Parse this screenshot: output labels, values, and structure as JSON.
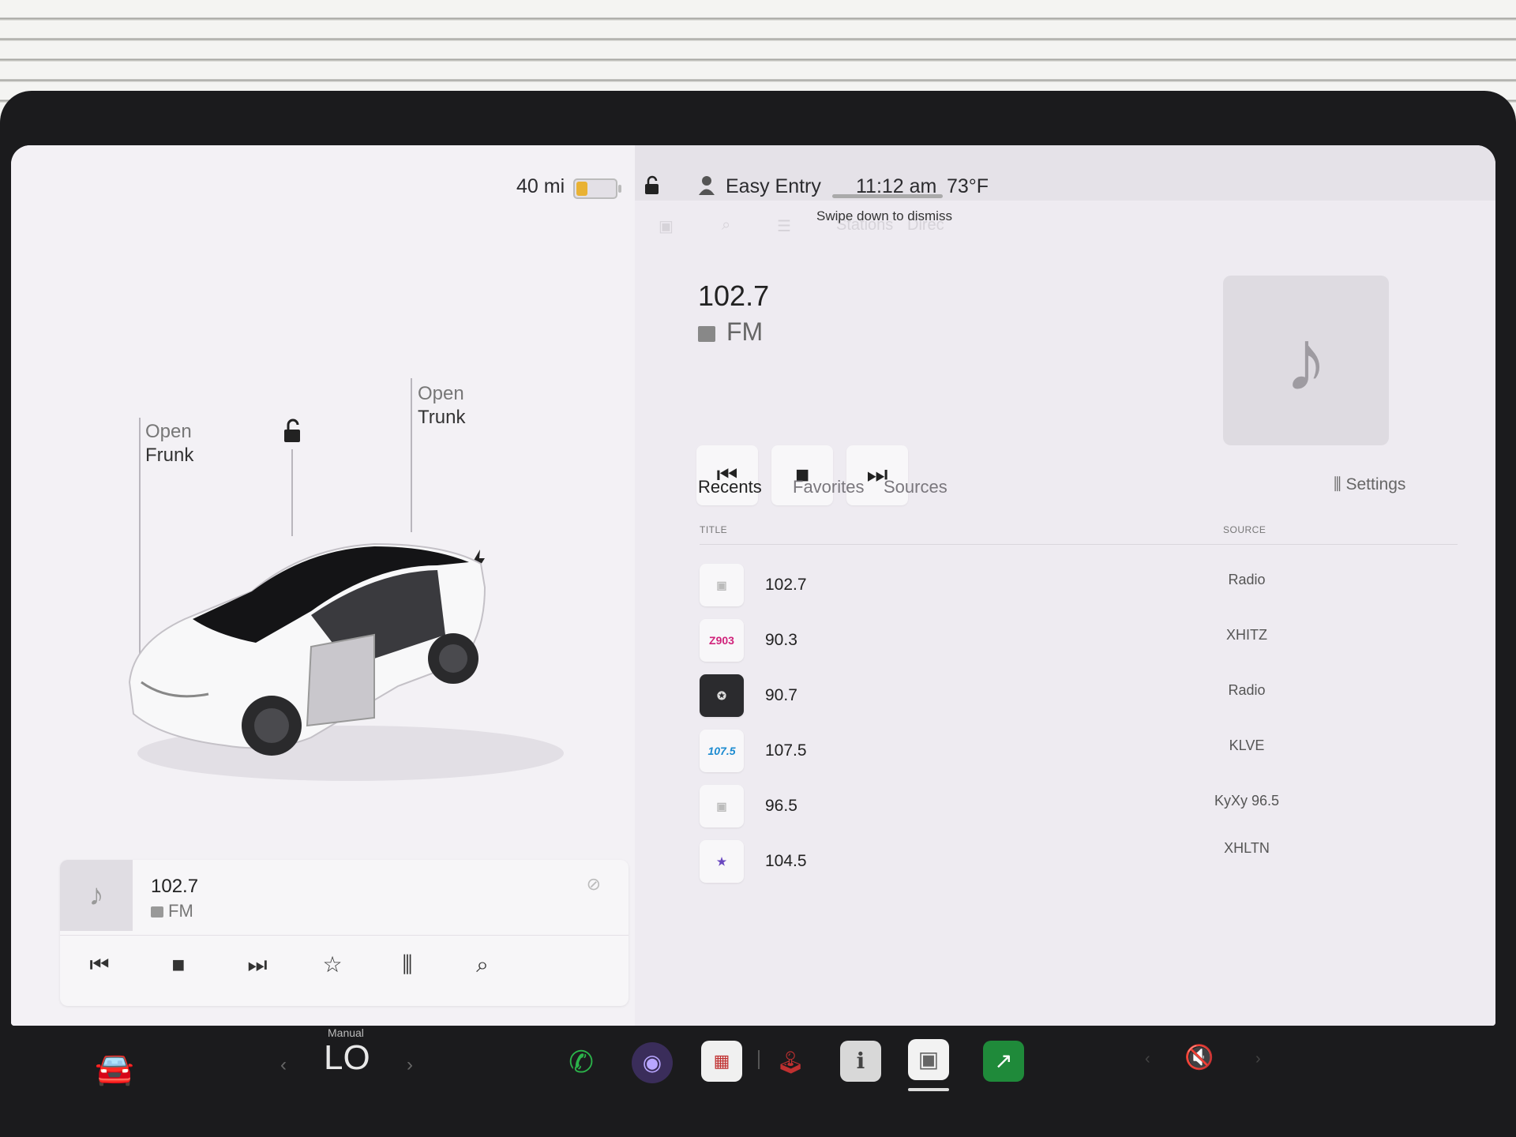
{
  "status": {
    "range": "40 mi",
    "battery_level": 0.3,
    "profile": "Easy Entry",
    "time": "11:12 am",
    "temperature": "73°F"
  },
  "car": {
    "frunk_label": "Open\nFrunk",
    "frunk_line1": "Open",
    "frunk_line2": "Frunk",
    "trunk_line1": "Open",
    "trunk_line2": "Trunk"
  },
  "mini_player": {
    "title": "102.7",
    "subtitle": "FM"
  },
  "media": {
    "swipe_hint": "Swipe down to dismiss",
    "ghost_tabs": [
      "Stations",
      "Direc"
    ],
    "station": "102.7",
    "band": "FM",
    "tabs": [
      "Recents",
      "Favorites",
      "Sources"
    ],
    "settings": "Settings",
    "col_title": "TITLE",
    "col_source": "SOURCE",
    "rows": [
      {
        "title": "102.7",
        "source": "Radio",
        "logo": ""
      },
      {
        "title": "90.3",
        "source": "XHITZ",
        "logo": "Z903"
      },
      {
        "title": "90.7",
        "source": "Radio",
        "logo": ""
      },
      {
        "title": "107.5",
        "source": "KLVE",
        "logo": "107.5"
      },
      {
        "title": "96.5",
        "source": "KyXy 96.5",
        "logo": ""
      },
      {
        "title": "104.5",
        "source": "XHLTN",
        "logo": ""
      }
    ]
  },
  "dock": {
    "climate_mode": "Manual",
    "climate_temp": "LO"
  },
  "colors": {
    "accent_green": "#2bb34a",
    "battery_yellow": "#e9b233"
  }
}
